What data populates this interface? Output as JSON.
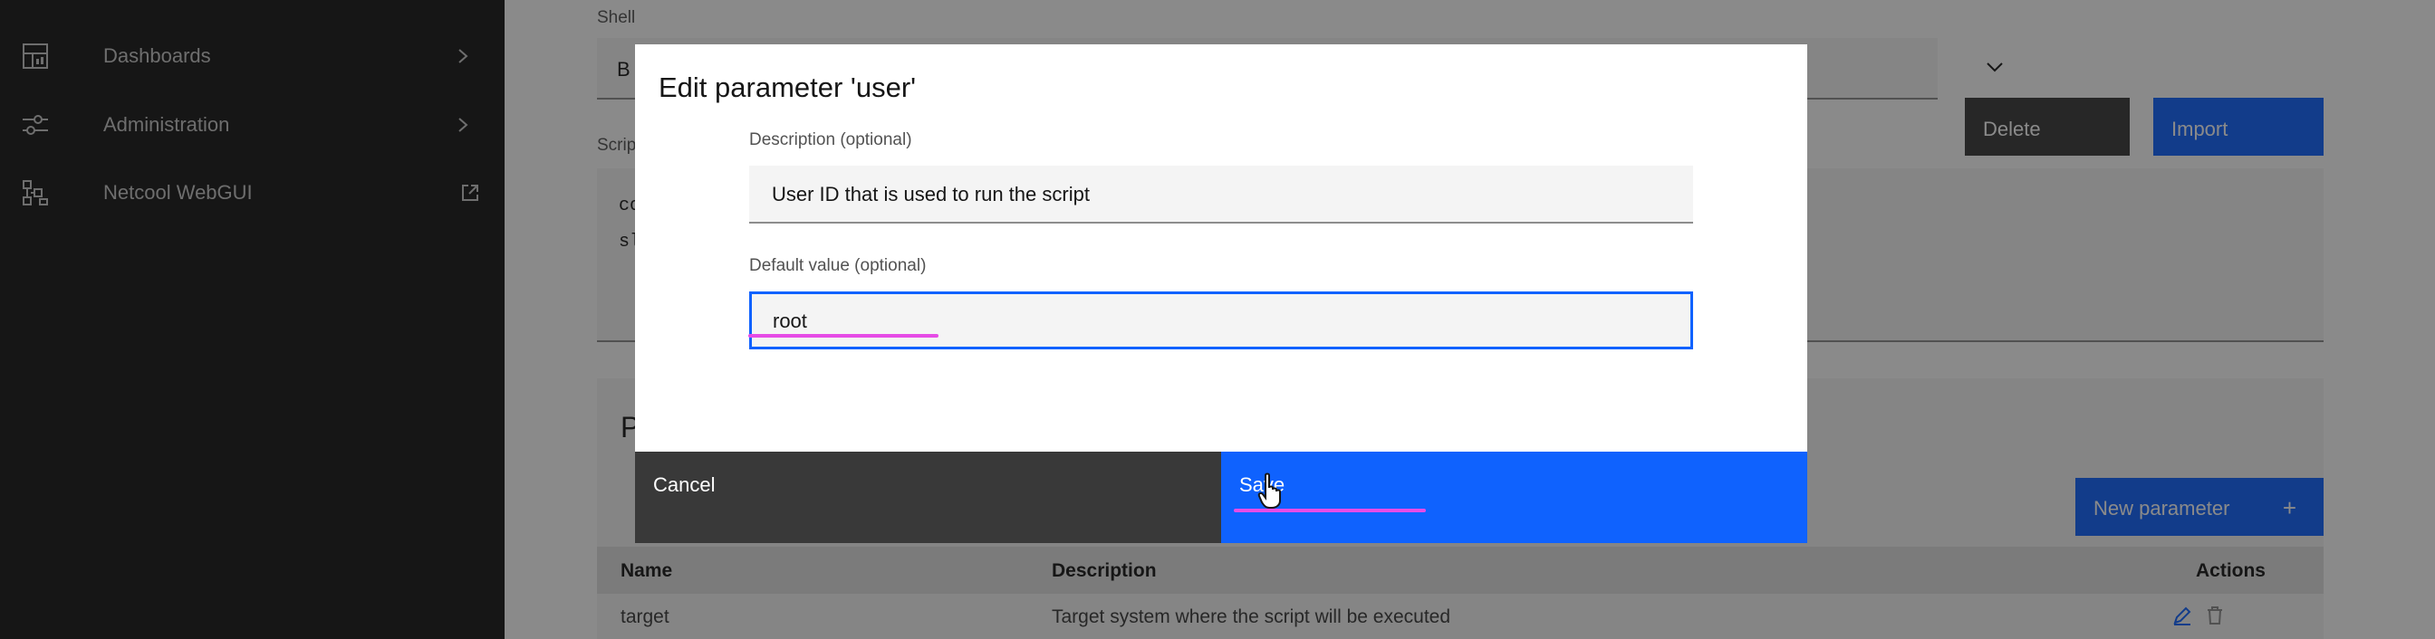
{
  "sidebar": {
    "items": [
      {
        "label": "Dashboards",
        "icon": "dashboard-icon",
        "trail_icon": "chevron-right-icon"
      },
      {
        "label": "Administration",
        "icon": "sliders-icon",
        "trail_icon": "chevron-right-icon"
      },
      {
        "label": "Netcool WebGUI",
        "icon": "network-icon",
        "trail_icon": "external-link-icon"
      }
    ]
  },
  "main": {
    "shell_label": "Shell",
    "shell_value": "B",
    "script_label": "Scrip",
    "delete_label": "Delete",
    "import_label": "Import",
    "script_lines": "co\nsl",
    "params_title": "P",
    "new_param_label": "New parameter",
    "new_param_icon": "+",
    "table": {
      "headers": [
        "Name",
        "Description",
        "Actions"
      ],
      "rows": [
        {
          "name": "target",
          "description": "Target system where the script will be executed"
        }
      ]
    }
  },
  "modal": {
    "title": "Edit parameter 'user'",
    "description_label": "Description (optional)",
    "description_value": "User ID that is used to run the script",
    "default_label": "Default value (optional)",
    "default_value": "root",
    "cancel_label": "Cancel",
    "save_label": "Save"
  },
  "colors": {
    "primary": "#0f62fe",
    "sidebar_bg": "#161616",
    "annotation": "#e64ce6"
  }
}
